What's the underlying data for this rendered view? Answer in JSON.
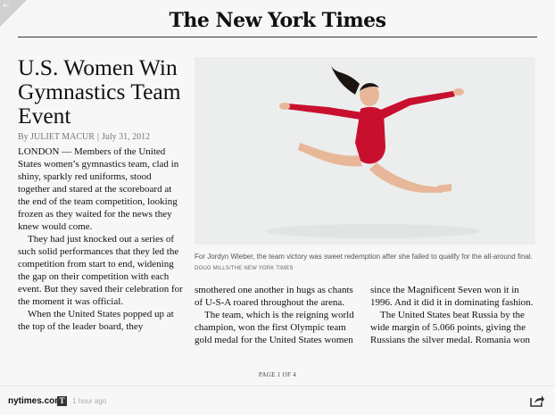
{
  "masthead": "The New York Times",
  "article": {
    "headline": "U.S. Women Win Gymnastics Team Event",
    "byline_author": "By JULIET MACUR",
    "byline_separator": "|",
    "byline_date": "July 31, 2012",
    "col1": [
      "LONDON — Members of the United States women’s gymnastics team, clad in shiny, sparkly red uniforms, stood together and stared at the scoreboard at the end of the team competition, looking frozen as they waited for the news they knew would come.",
      "They had just knocked out a series of such solid performances that they led the competition from start to end, widening the gap on their competition with each event. But they saved their celebration for the moment it was official.",
      "When the United States popped up at the top of the leader board, they"
    ],
    "col2": [
      "smothered one another in hugs as chants of U-S-A roared throughout the arena.",
      "The team, which is the reigning world champion, won the first Olympic team gold medal for the United States women"
    ],
    "col3": [
      "since the Magnificent Seven won it in 1996. And it did it in dominating fashion.",
      "The United States beat Russia by the wide margin of 5.066 points, giving the Russians the silver medal. Romania won"
    ],
    "photo_caption": "For Jordyn Wieber, the team victory was sweet redemption after she failed to qualify for the all-around final.",
    "photo_credit": "DOUG MILLS/THE NEW YORK TIMES"
  },
  "pager": "PAGE 1 OF 4",
  "footer": {
    "site": "nytimes.com",
    "badge": "T",
    "timestamp": "1 hour ago"
  },
  "colors": {
    "leotard": "#c8102e",
    "background": "#f7f7f7"
  }
}
